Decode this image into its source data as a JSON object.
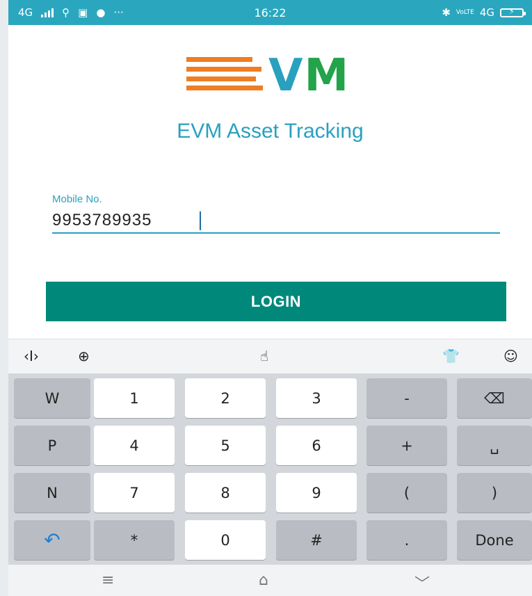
{
  "status_bar": {
    "network_left": "4G",
    "time": "16:22",
    "network_right": "4G",
    "volte": "VoLTE",
    "more": "···"
  },
  "logo": {
    "letter_v": "V",
    "letter_m": "M"
  },
  "app_title": "EVM Asset Tracking",
  "mobile_field": {
    "label": "Mobile No.",
    "value": "9953789935"
  },
  "login_button": "LOGIN",
  "keyboard_toolbar": {
    "cursor_icon": "‹I›",
    "globe_icon": "⊕",
    "touchpal_icon": "☝",
    "shirt_icon": "👕",
    "emoji_icon": "☺"
  },
  "keyboard_rows": [
    [
      "W",
      "1",
      "2",
      "3",
      "-",
      "⌫"
    ],
    [
      "P",
      "4",
      "5",
      "6",
      "+",
      "␣"
    ],
    [
      "N",
      "7",
      "8",
      "9",
      "(",
      ")"
    ],
    [
      "↶",
      "*",
      "0",
      "#",
      ".",
      "Done"
    ]
  ],
  "nav_bar": {
    "menu": "≡",
    "home": "⌂",
    "back": "﹀"
  },
  "colors": {
    "accent": "#2aa0bf",
    "button": "#00897b",
    "orange": "#ef7d22",
    "green": "#23a34a"
  }
}
